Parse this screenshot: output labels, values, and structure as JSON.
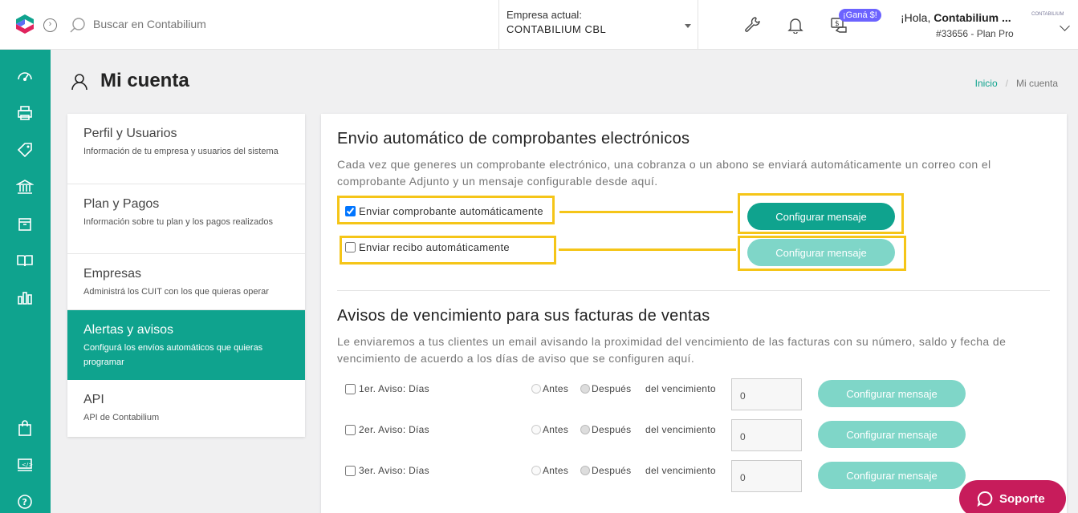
{
  "header": {
    "search_placeholder": "Buscar en Contabilium",
    "company_label": "Empresa actual:",
    "company_value": "CONTABILIUM CBL",
    "gana_badge": "¡Ganá $!",
    "greeting": "¡Hola, ",
    "user_name": "Contabilium ...",
    "plan": "#33656 - Plan Pro",
    "mini_logo_text": "CONTABILIUM"
  },
  "sidebar": {
    "icons": [
      "dashboard-icon",
      "printer-icon",
      "tag-icon",
      "bank-icon",
      "box-icon",
      "book-icon",
      "bar-chart-icon",
      "shopping-bag-icon",
      "monitor-icon",
      "help-icon"
    ]
  },
  "page": {
    "title": "Mi cuenta",
    "breadcrumb_home": "Inicio",
    "breadcrumb_sep": "/",
    "breadcrumb_current": "Mi cuenta"
  },
  "menu": {
    "items": [
      {
        "title": "Perfil y Usuarios",
        "desc": "Información de tu empresa y usuarios del sistema"
      },
      {
        "title": "Plan y Pagos",
        "desc": "Información sobre tu plan y los pagos realizados"
      },
      {
        "title": "Empresas",
        "desc": "Administrá los CUIT con los que quieras operar"
      },
      {
        "title": "Alertas y avisos",
        "desc": "Configurá los envíos automáticos que quieras programar"
      },
      {
        "title": "API",
        "desc": "API de Contabilium"
      }
    ],
    "active_index": 3
  },
  "envio": {
    "title": "Envio automático de comprobantes electrónicos",
    "desc": "Cada vez que generes un comprobante electrónico, una cobranza o un abono se enviará automáticamente un correo con el comprobante Adjunto y un mensaje configurable desde aquí.",
    "check1_label": "Enviar comprobante automáticamente",
    "check1_checked": true,
    "check2_label": "Enviar recibo automáticamente",
    "check2_checked": false,
    "button_label": "Configurar mensaje"
  },
  "avisos": {
    "title": "Avisos de vencimiento para sus facturas de ventas",
    "desc": "Le enviaremos a tus clientes un email avisando la proximidad del vencimiento de las facturas con su número, saldo y fecha de vencimiento de acuerdo a los días de aviso que se configuren aquí.",
    "rows": [
      {
        "label": "1er. Aviso: Días",
        "antes": "Antes",
        "despues": "Después",
        "venc": "del vencimiento",
        "value": "0",
        "button": "Configurar mensaje"
      },
      {
        "label": "2er. Aviso: Días",
        "antes": "Antes",
        "despues": "Después",
        "venc": "del vencimiento",
        "value": "0",
        "button": "Configurar mensaje"
      },
      {
        "label": "3er. Aviso: Días",
        "antes": "Antes",
        "despues": "Después",
        "venc": "del vencimiento",
        "value": "0",
        "button": "Configurar mensaje"
      }
    ]
  },
  "soporte": {
    "label": "Soporte"
  },
  "colors": {
    "brand": "#0fa38e",
    "brand_light": "#7fd6c8",
    "highlight": "#f5c518",
    "support": "#c71c5b"
  }
}
